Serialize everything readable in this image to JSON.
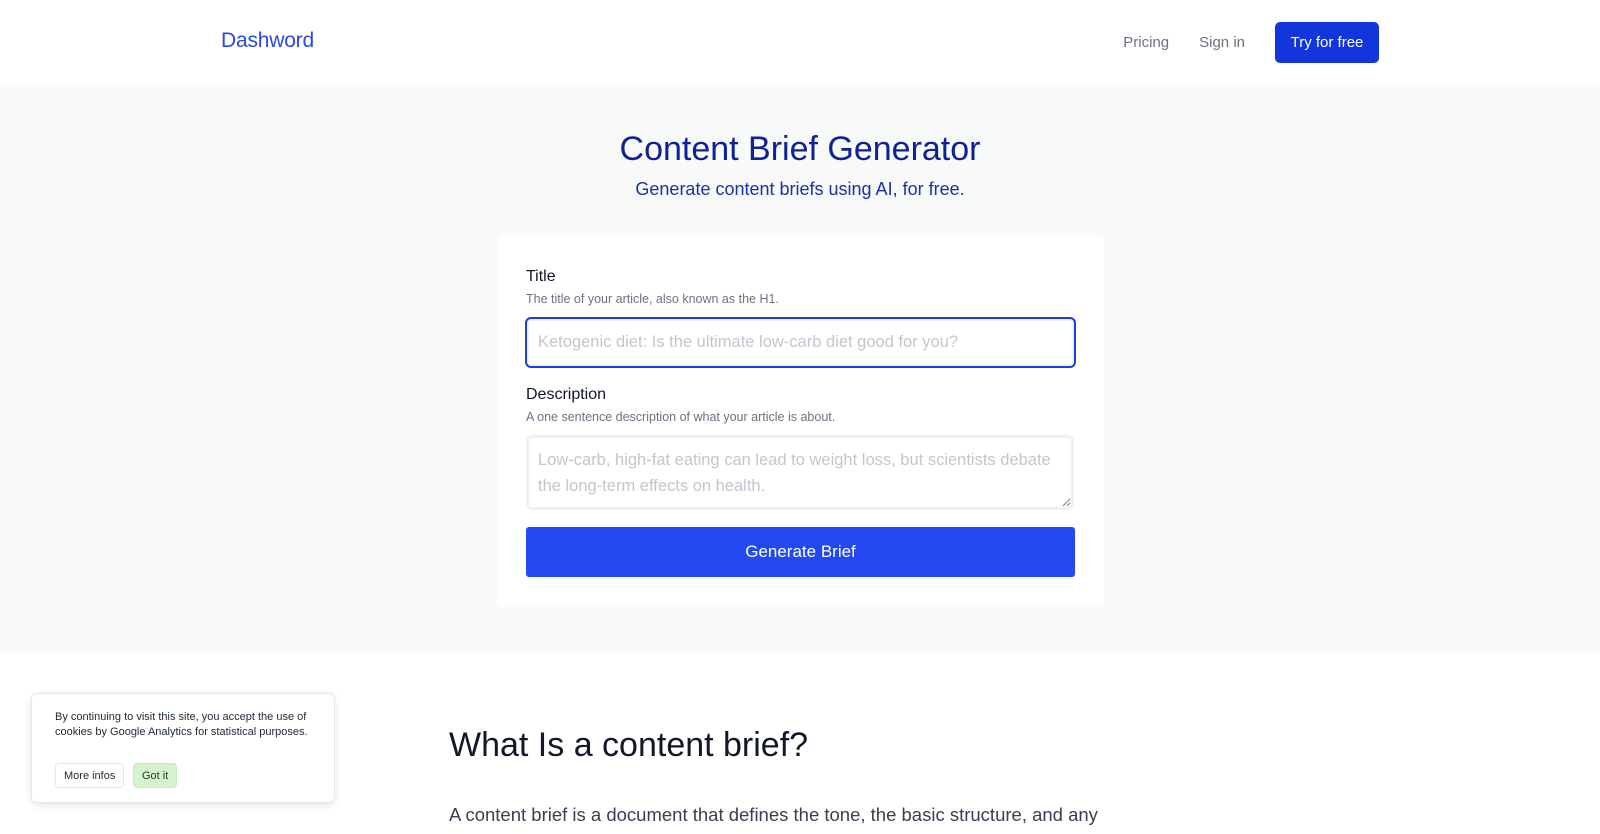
{
  "header": {
    "logo": "Dashword",
    "nav": {
      "pricing": "Pricing",
      "sign_in": "Sign in",
      "cta": "Try for free"
    }
  },
  "hero": {
    "title": "Content Brief Generator",
    "subtitle": "Generate content briefs using AI, for free."
  },
  "form": {
    "title_field": {
      "label": "Title",
      "help": "The title of your article, also known as the H1.",
      "value": "",
      "placeholder": "Ketogenic diet: Is the ultimate low-carb diet good for you?"
    },
    "description_field": {
      "label": "Description",
      "help": "A one sentence description of what your article is about.",
      "value": "",
      "placeholder": "Low-carb, high-fat eating can lead to weight loss, but scientists debate the long-term effects on health."
    },
    "submit_label": "Generate Brief"
  },
  "content": {
    "heading": "What Is a content brief?",
    "paragraph": "A content brief is a document that defines the tone, the basic structure, and any"
  },
  "cookie_banner": {
    "text": "By continuing to visit this site, you accept the use of cookies by Google Analytics for statistical purposes.",
    "more_label": "More infos",
    "accept_label": "Got it"
  },
  "colors": {
    "brand": "#2a48e6",
    "cta": "#1235dc",
    "button": "#2448ef",
    "hero_title": "#0f2196",
    "cookie_accept": "#d6f3cf"
  }
}
